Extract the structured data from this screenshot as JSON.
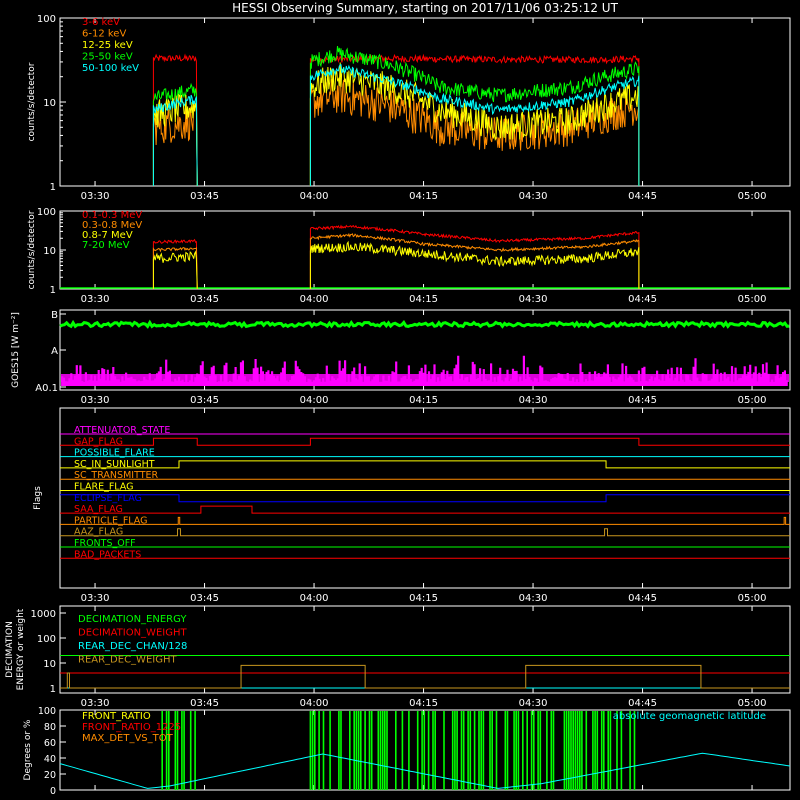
{
  "title": "HESSI Observing Summary, starting on 2017/11/06 03:25:12 UT",
  "time_ticks": [
    "03:30",
    "03:45",
    "04:00",
    "04:15",
    "04:30",
    "04:45",
    "05:00"
  ],
  "time_tick_minutes": [
    4.8,
    19.8,
    34.8,
    49.8,
    64.8,
    79.8,
    94.8
  ],
  "time_range_minutes": [
    0,
    100
  ],
  "colors": {
    "red": "#ff0000",
    "orange": "#ff8c00",
    "yellow": "#ffff00",
    "green": "#00ff00",
    "cyan": "#00ffff",
    "magenta": "#ff00ff",
    "blue": "#0000ff",
    "brown": "#c8961e",
    "white": "#ffffff"
  },
  "chart_data": [
    {
      "type": "line",
      "panel": "hxr",
      "ylabel": "counts/s/detector",
      "yscale": "log",
      "ylim": [
        1,
        100
      ],
      "yticks": [
        "1",
        "10",
        "100"
      ],
      "data_windows_minutes": [
        [
          12.8,
          18.8
        ],
        [
          34.3,
          79.3
        ]
      ],
      "series": [
        {
          "name": "3-6 keV",
          "color": "#ff0000",
          "points": [
            [
              12.8,
              33
            ],
            [
              18.8,
              33
            ],
            [
              34.3,
              32
            ],
            [
              45,
              33
            ],
            [
              60,
              32
            ],
            [
              75,
              32
            ],
            [
              79.3,
              33
            ]
          ]
        },
        {
          "name": "6-12 keV",
          "color": "#ff8c00",
          "points": [
            [
              12.8,
              5
            ],
            [
              18.8,
              6
            ],
            [
              34.3,
              10
            ],
            [
              38,
              12
            ],
            [
              45,
              9
            ],
            [
              52,
              5
            ],
            [
              60,
              4
            ],
            [
              70,
              5
            ],
            [
              79.3,
              9
            ]
          ]
        },
        {
          "name": "12-25 keV",
          "color": "#ffff00",
          "points": [
            [
              12.8,
              7
            ],
            [
              18.8,
              9
            ],
            [
              34.3,
              15
            ],
            [
              38,
              20
            ],
            [
              45,
              15
            ],
            [
              52,
              8
            ],
            [
              60,
              5
            ],
            [
              70,
              6
            ],
            [
              79.3,
              12
            ]
          ]
        },
        {
          "name": "25-50 keV",
          "color": "#00ff00",
          "points": [
            [
              12.8,
              11
            ],
            [
              18.8,
              14
            ],
            [
              34.3,
              30
            ],
            [
              38,
              38
            ],
            [
              45,
              28
            ],
            [
              52,
              15
            ],
            [
              60,
              12
            ],
            [
              70,
              15
            ],
            [
              79.3,
              25
            ]
          ]
        },
        {
          "name": "50-100 keV",
          "color": "#00ffff",
          "points": [
            [
              12.8,
              8
            ],
            [
              18.8,
              11
            ],
            [
              34.3,
              20
            ],
            [
              38,
              25
            ],
            [
              45,
              18
            ],
            [
              52,
              11
            ],
            [
              60,
              8
            ],
            [
              70,
              10
            ],
            [
              79.3,
              18
            ]
          ]
        }
      ]
    },
    {
      "type": "line",
      "panel": "gamma",
      "ylabel": "counts/s/detector",
      "yscale": "log",
      "ylim": [
        1,
        100
      ],
      "yticks": [
        "1",
        "10",
        "100"
      ],
      "data_windows_minutes": [
        [
          12.8,
          18.8
        ],
        [
          34.3,
          79.3
        ]
      ],
      "series": [
        {
          "name": "0.1-0.3 MeV",
          "color": "#ff0000",
          "points": [
            [
              12.8,
              16
            ],
            [
              18.8,
              17
            ],
            [
              34.3,
              35
            ],
            [
              40,
              40
            ],
            [
              50,
              25
            ],
            [
              60,
              17
            ],
            [
              72,
              20
            ],
            [
              79.3,
              28
            ]
          ]
        },
        {
          "name": "0.3-0.8 MeV",
          "color": "#ff8c00",
          "points": [
            [
              12.8,
              10
            ],
            [
              18.8,
              11
            ],
            [
              34.3,
              20
            ],
            [
              40,
              24
            ],
            [
              50,
              14
            ],
            [
              60,
              10
            ],
            [
              72,
              12
            ],
            [
              79.3,
              17
            ]
          ]
        },
        {
          "name": "0.8-7 MeV",
          "color": "#ffff00",
          "points": [
            [
              12.8,
              6
            ],
            [
              18.8,
              7
            ],
            [
              34.3,
              11
            ],
            [
              40,
              12
            ],
            [
              50,
              8
            ],
            [
              60,
              5
            ],
            [
              72,
              6
            ],
            [
              79.3,
              9
            ]
          ]
        },
        {
          "name": "7-20 MeV",
          "color": "#00ff00",
          "points": [
            [
              0,
              1
            ],
            [
              100,
              1
            ]
          ]
        }
      ]
    },
    {
      "type": "line",
      "panel": "goes",
      "ylabel": "GOES15 [W m⁻²]",
      "ytick_labels": [
        "A0.1",
        "A",
        "B"
      ],
      "series": [
        {
          "name": "green",
          "color": "#00ff00",
          "level": 0.82
        },
        {
          "name": "magenta",
          "color": "#ff00ff",
          "level": 0.12
        }
      ]
    },
    {
      "type": "line",
      "panel": "flags",
      "ylabel": "Flags",
      "series": [
        {
          "name": "ATTENUATOR_STATE",
          "color": "#ff00ff",
          "steps": [
            [
              0,
              0
            ]
          ]
        },
        {
          "name": "GAP_FLAG",
          "color": "#ff0000",
          "steps": [
            [
              0,
              0
            ],
            [
              12.8,
              1
            ],
            [
              18.8,
              0
            ],
            [
              34.3,
              1
            ],
            [
              79.3,
              0
            ]
          ]
        },
        {
          "name": "POSSIBLE_FLARE",
          "color": "#00ffff",
          "steps": [
            [
              0,
              0
            ]
          ]
        },
        {
          "name": "SC_IN_SUNLIGHT",
          "color": "#ffff00",
          "steps": [
            [
              0,
              0
            ],
            [
              16.3,
              1
            ],
            [
              74.8,
              0
            ]
          ]
        },
        {
          "name": "SC_TRANSMITTER",
          "color": "#ff8c00",
          "steps": [
            [
              0,
              0
            ]
          ]
        },
        {
          "name": "FLARE_FLAG",
          "color": "#ffff00",
          "steps": [
            [
              0,
              0
            ]
          ]
        },
        {
          "name": "ECLIPSE_FLAG",
          "color": "#0000ff",
          "steps": [
            [
              0,
              1
            ],
            [
              16.3,
              0
            ],
            [
              74.8,
              1
            ]
          ]
        },
        {
          "name": "SAA_FLAG",
          "color": "#ff0000",
          "steps": [
            [
              0,
              0
            ],
            [
              19.3,
              1
            ],
            [
              26.3,
              0
            ]
          ]
        },
        {
          "name": "PARTICLE_FLAG",
          "color": "#ff8c00",
          "steps": [
            [
              0,
              0
            ],
            [
              16.2,
              1
            ],
            [
              16.4,
              0
            ],
            [
              99.2,
              1
            ],
            [
              99.4,
              0
            ]
          ]
        },
        {
          "name": "AAZ_FLAG",
          "color": "#c8961e",
          "steps": [
            [
              0,
              0
            ],
            [
              16.1,
              1
            ],
            [
              16.5,
              0
            ],
            [
              74.6,
              1
            ],
            [
              75.0,
              0
            ]
          ]
        },
        {
          "name": "FRONTS_OFF",
          "color": "#00ff00",
          "steps": [
            [
              0,
              0
            ]
          ]
        },
        {
          "name": "BAD_PACKETS",
          "color": "#ff0000",
          "steps": [
            [
              0,
              0
            ]
          ]
        }
      ]
    },
    {
      "type": "line",
      "panel": "decimation",
      "ylabel": "DECIMATION ENERGY or weight",
      "yscale": "log",
      "yticks": [
        "1",
        "10",
        "100",
        "1000"
      ],
      "series": [
        {
          "name": "DECIMATION_ENERGY",
          "color": "#00ff00",
          "points": [
            [
              0,
              20
            ],
            [
              100,
              20
            ]
          ]
        },
        {
          "name": "DECIMATION_WEIGHT",
          "color": "#ff0000",
          "points": [
            [
              0,
              4
            ],
            [
              100,
              4
            ]
          ]
        },
        {
          "name": "REAR_DEC_CHAN/128",
          "color": "#00ffff",
          "points": [
            [
              0,
              1
            ],
            [
              100,
              1
            ]
          ]
        },
        {
          "name": "REAR_DEC_WEIGHT",
          "color": "#c8961e",
          "steps": [
            [
              0,
              1
            ],
            [
              1,
              4
            ],
            [
              1.3,
              1
            ],
            [
              24.8,
              8
            ],
            [
              41.8,
              1
            ],
            [
              63.8,
              8
            ],
            [
              87.8,
              1
            ],
            [
              100,
              1
            ]
          ]
        }
      ]
    },
    {
      "type": "line",
      "panel": "ratio",
      "ylabel": "Degrees or %",
      "ylim": [
        0,
        100
      ],
      "yticks": [
        "0",
        "20",
        "40",
        "60",
        "80",
        "100"
      ],
      "annotation": "absolute geomagnetic latitude",
      "series": [
        {
          "name": "FRONT_RATIO",
          "color": "#ffff00"
        },
        {
          "name": "FRONT_RATIO_1225",
          "color": "#ff0000"
        },
        {
          "name": "MAX_DET_VS_TOT",
          "color": "#ff8c00"
        },
        {
          "name": "absolute geomagnetic latitude",
          "color": "#00ffff",
          "points": [
            [
              0,
              33
            ],
            [
              12,
              2
            ],
            [
              15,
              5
            ],
            [
              36,
              45
            ],
            [
              60,
              2
            ],
            [
              66,
              8
            ],
            [
              88,
              46
            ],
            [
              100,
              30
            ]
          ]
        }
      ],
      "green_bar_windows": [
        [
          12.8,
          18.8
        ],
        [
          34.3,
          79.3
        ]
      ]
    }
  ]
}
